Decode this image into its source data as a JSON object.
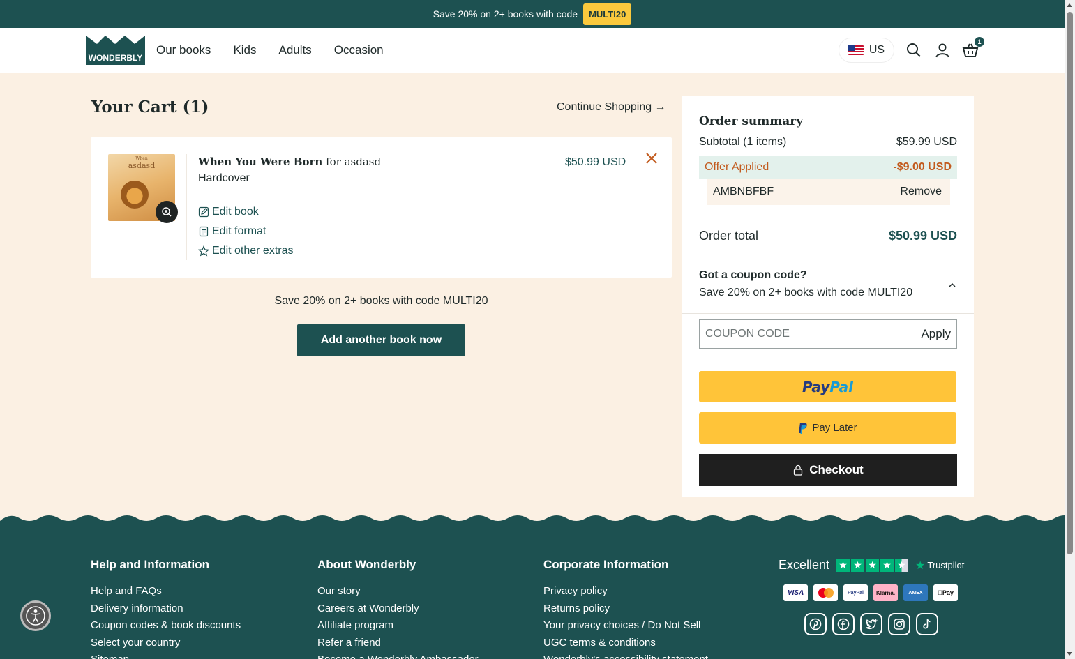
{
  "promo": {
    "text": "Save 20% on 2+ books with code",
    "code": "MULTI20"
  },
  "header": {
    "logo_text": "WONDERBLY",
    "nav": [
      "Our books",
      "Kids",
      "Adults",
      "Occasion"
    ],
    "locale": "US",
    "cart_count": "1"
  },
  "cart": {
    "title": "Your Cart (1)",
    "continue": "Continue Shopping →",
    "item": {
      "thumb_line1": "When",
      "thumb_line2": "asdasd",
      "title_bold": "When You Were Born",
      "title_rest": " for asdasd",
      "format": "Hardcover",
      "price": "$50.99 USD",
      "edit_book": "Edit book",
      "edit_format": "Edit format",
      "edit_extras": "Edit other extras"
    },
    "save_note": "Save 20% on 2+ books with code MULTI20",
    "add_button": "Add another book now"
  },
  "summary": {
    "title": "Order summary",
    "subtotal_label": "Subtotal (1 items)",
    "subtotal_value": "$59.99 USD",
    "offer_label": "Offer Applied",
    "offer_value": "-$9.00 USD",
    "applied_code": "AMBNBFBF",
    "remove": "Remove",
    "total_label": "Order total",
    "total_value": "$50.99 USD",
    "coupon_heading": "Got a coupon code?",
    "coupon_sub": "Save 20% on 2+ books with code MULTI20",
    "coupon_placeholder": "COUPON CODE",
    "apply": "Apply",
    "paypal_p1": "Pay",
    "paypal_p2": "Pal",
    "paylater": "Pay Later",
    "checkout": "Checkout"
  },
  "footer": {
    "col1": {
      "title": "Help and Information",
      "links": [
        "Help and FAQs",
        "Delivery information",
        "Coupon codes & book discounts",
        "Select your country",
        "Sitemap"
      ]
    },
    "col2": {
      "title": "About Wonderbly",
      "links": [
        "Our story",
        "Careers at Wonderbly",
        "Affiliate program",
        "Refer a friend",
        "Become a Wonderbly Ambassador"
      ]
    },
    "col3": {
      "title": "Corporate Information",
      "links": [
        "Privacy policy",
        "Returns policy",
        "Your privacy choices / Do Not Sell",
        "UGC terms & conditions",
        "Wonderbly's accessibility statement"
      ]
    },
    "trustpilot": {
      "rating": "Excellent",
      "brand": "Trustpilot"
    },
    "cards": [
      "VISA",
      "mastercard",
      "PayPal",
      "Klarna.",
      "AMEX",
      "Pay"
    ],
    "socials": [
      "pinterest-icon",
      "facebook-icon",
      "twitter-icon",
      "instagram-icon",
      "tiktok-icon"
    ]
  },
  "colors": {
    "brand": "#1d5151",
    "accent": "#fbc93d",
    "page_bg": "#fbf0e3",
    "offer": "#c25a1d"
  }
}
